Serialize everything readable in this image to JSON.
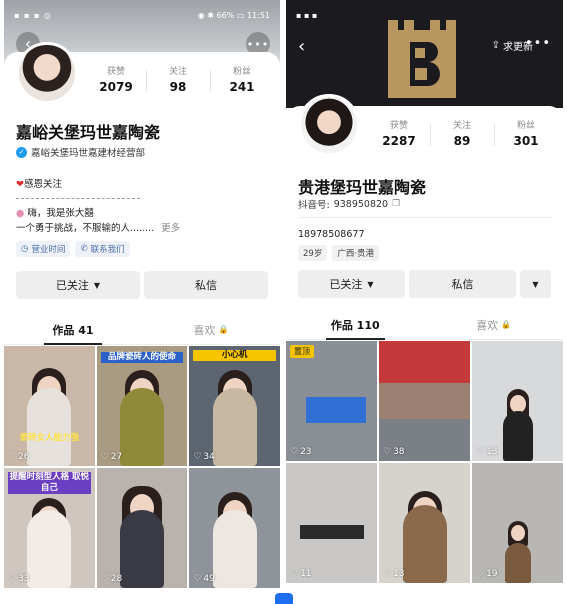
{
  "left": {
    "status": {
      "left": "▪ ▪ ▪ ◎",
      "right": "◉ ✱ 66% ▭ 11:51"
    },
    "stats": [
      {
        "label": "获赞",
        "value": "2079"
      },
      {
        "label": "关注",
        "value": "98"
      },
      {
        "label": "粉丝",
        "value": "241"
      }
    ],
    "name": "嘉峪关堡玛世嘉陶瓷",
    "verified_text": "嘉峪关堡玛世嘉建材经营部",
    "bio_line1": "感恩关注",
    "bio_line2": "嗨，我是张大囍",
    "bio_line3": "一个勇于挑战，不服输的人........",
    "more_link": "更多",
    "chips": [
      {
        "label": "营业时间"
      },
      {
        "label": "联系我们"
      }
    ],
    "follow_btn": "已关注",
    "message_btn": "私信",
    "tabs": [
      {
        "label": "作品 41"
      },
      {
        "label": "喜欢"
      }
    ],
    "videos": [
      {
        "likes": "26",
        "caption": "瓷砖女人能力强",
        "bg": "#c9b8a8"
      },
      {
        "likes": "27",
        "caption": "品牌瓷砖人的使命",
        "bg": "#a99a82"
      },
      {
        "likes": "34",
        "caption": "小心机",
        "bg": "#5d6570"
      },
      {
        "likes": "33",
        "caption": "提醒时刻型人格 取悦自己",
        "bg": "#cfc6c0"
      },
      {
        "likes": "28",
        "caption": "",
        "bg": "#b9b2ad"
      },
      {
        "likes": "49",
        "caption": "",
        "bg": "#8f949a"
      }
    ]
  },
  "right": {
    "update_btn": "求更新",
    "stats": [
      {
        "label": "获赞",
        "value": "2287"
      },
      {
        "label": "关注",
        "value": "89"
      },
      {
        "label": "粉丝",
        "value": "301"
      }
    ],
    "name": "贵港堡玛世嘉陶瓷",
    "douyin_id_label": "抖音号: ",
    "douyin_id": "938950820",
    "phone": "18978508677",
    "chips": [
      {
        "label": "29岁"
      },
      {
        "label": "广西·贵港"
      }
    ],
    "follow_btn": "已关注",
    "message_btn": "私信",
    "tabs": [
      {
        "label": "作品 110"
      },
      {
        "label": "喜欢"
      }
    ],
    "pin_label": "置顶",
    "videos": [
      {
        "likes": "23",
        "pinned": true,
        "bg": "#8a8f95"
      },
      {
        "likes": "38",
        "pinned": true,
        "bg": "#9c8072"
      },
      {
        "likes": "13",
        "pinned": false,
        "bg": "#d8d9db"
      },
      {
        "likes": "11",
        "pinned": false,
        "bg": "#c9c8c6"
      },
      {
        "likes": "13",
        "pinned": false,
        "bg": "#d6d2cc"
      },
      {
        "likes": "19",
        "pinned": false,
        "bg": "#b8b7b4"
      }
    ]
  },
  "colors": {
    "accent_blue": "#1d9bf0",
    "pin_yellow": "#f7c400",
    "fab_blue": "#1e6ff0"
  }
}
